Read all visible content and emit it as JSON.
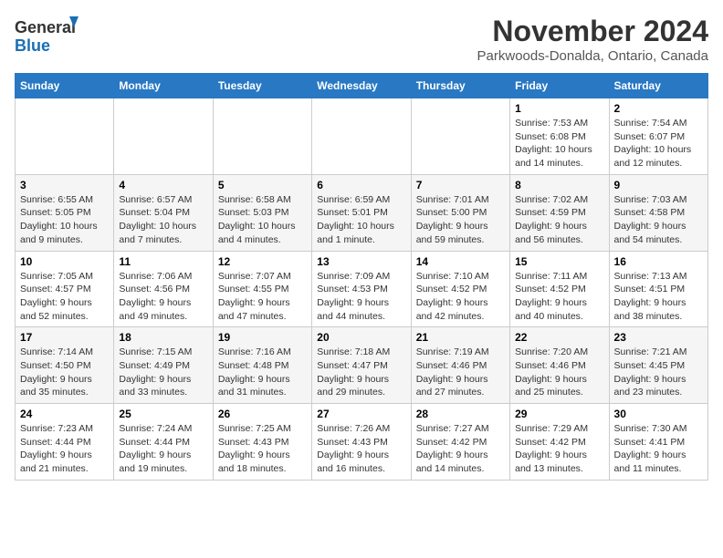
{
  "logo": {
    "line1": "General",
    "line2": "Blue"
  },
  "title": "November 2024",
  "location": "Parkwoods-Donalda, Ontario, Canada",
  "days_of_week": [
    "Sunday",
    "Monday",
    "Tuesday",
    "Wednesday",
    "Thursday",
    "Friday",
    "Saturday"
  ],
  "weeks": [
    [
      {
        "day": "",
        "info": ""
      },
      {
        "day": "",
        "info": ""
      },
      {
        "day": "",
        "info": ""
      },
      {
        "day": "",
        "info": ""
      },
      {
        "day": "",
        "info": ""
      },
      {
        "day": "1",
        "info": "Sunrise: 7:53 AM\nSunset: 6:08 PM\nDaylight: 10 hours and 14 minutes."
      },
      {
        "day": "2",
        "info": "Sunrise: 7:54 AM\nSunset: 6:07 PM\nDaylight: 10 hours and 12 minutes."
      }
    ],
    [
      {
        "day": "3",
        "info": "Sunrise: 6:55 AM\nSunset: 5:05 PM\nDaylight: 10 hours and 9 minutes."
      },
      {
        "day": "4",
        "info": "Sunrise: 6:57 AM\nSunset: 5:04 PM\nDaylight: 10 hours and 7 minutes."
      },
      {
        "day": "5",
        "info": "Sunrise: 6:58 AM\nSunset: 5:03 PM\nDaylight: 10 hours and 4 minutes."
      },
      {
        "day": "6",
        "info": "Sunrise: 6:59 AM\nSunset: 5:01 PM\nDaylight: 10 hours and 1 minute."
      },
      {
        "day": "7",
        "info": "Sunrise: 7:01 AM\nSunset: 5:00 PM\nDaylight: 9 hours and 59 minutes."
      },
      {
        "day": "8",
        "info": "Sunrise: 7:02 AM\nSunset: 4:59 PM\nDaylight: 9 hours and 56 minutes."
      },
      {
        "day": "9",
        "info": "Sunrise: 7:03 AM\nSunset: 4:58 PM\nDaylight: 9 hours and 54 minutes."
      }
    ],
    [
      {
        "day": "10",
        "info": "Sunrise: 7:05 AM\nSunset: 4:57 PM\nDaylight: 9 hours and 52 minutes."
      },
      {
        "day": "11",
        "info": "Sunrise: 7:06 AM\nSunset: 4:56 PM\nDaylight: 9 hours and 49 minutes."
      },
      {
        "day": "12",
        "info": "Sunrise: 7:07 AM\nSunset: 4:55 PM\nDaylight: 9 hours and 47 minutes."
      },
      {
        "day": "13",
        "info": "Sunrise: 7:09 AM\nSunset: 4:53 PM\nDaylight: 9 hours and 44 minutes."
      },
      {
        "day": "14",
        "info": "Sunrise: 7:10 AM\nSunset: 4:52 PM\nDaylight: 9 hours and 42 minutes."
      },
      {
        "day": "15",
        "info": "Sunrise: 7:11 AM\nSunset: 4:52 PM\nDaylight: 9 hours and 40 minutes."
      },
      {
        "day": "16",
        "info": "Sunrise: 7:13 AM\nSunset: 4:51 PM\nDaylight: 9 hours and 38 minutes."
      }
    ],
    [
      {
        "day": "17",
        "info": "Sunrise: 7:14 AM\nSunset: 4:50 PM\nDaylight: 9 hours and 35 minutes."
      },
      {
        "day": "18",
        "info": "Sunrise: 7:15 AM\nSunset: 4:49 PM\nDaylight: 9 hours and 33 minutes."
      },
      {
        "day": "19",
        "info": "Sunrise: 7:16 AM\nSunset: 4:48 PM\nDaylight: 9 hours and 31 minutes."
      },
      {
        "day": "20",
        "info": "Sunrise: 7:18 AM\nSunset: 4:47 PM\nDaylight: 9 hours and 29 minutes."
      },
      {
        "day": "21",
        "info": "Sunrise: 7:19 AM\nSunset: 4:46 PM\nDaylight: 9 hours and 27 minutes."
      },
      {
        "day": "22",
        "info": "Sunrise: 7:20 AM\nSunset: 4:46 PM\nDaylight: 9 hours and 25 minutes."
      },
      {
        "day": "23",
        "info": "Sunrise: 7:21 AM\nSunset: 4:45 PM\nDaylight: 9 hours and 23 minutes."
      }
    ],
    [
      {
        "day": "24",
        "info": "Sunrise: 7:23 AM\nSunset: 4:44 PM\nDaylight: 9 hours and 21 minutes."
      },
      {
        "day": "25",
        "info": "Sunrise: 7:24 AM\nSunset: 4:44 PM\nDaylight: 9 hours and 19 minutes."
      },
      {
        "day": "26",
        "info": "Sunrise: 7:25 AM\nSunset: 4:43 PM\nDaylight: 9 hours and 18 minutes."
      },
      {
        "day": "27",
        "info": "Sunrise: 7:26 AM\nSunset: 4:43 PM\nDaylight: 9 hours and 16 minutes."
      },
      {
        "day": "28",
        "info": "Sunrise: 7:27 AM\nSunset: 4:42 PM\nDaylight: 9 hours and 14 minutes."
      },
      {
        "day": "29",
        "info": "Sunrise: 7:29 AM\nSunset: 4:42 PM\nDaylight: 9 hours and 13 minutes."
      },
      {
        "day": "30",
        "info": "Sunrise: 7:30 AM\nSunset: 4:41 PM\nDaylight: 9 hours and 11 minutes."
      }
    ]
  ]
}
